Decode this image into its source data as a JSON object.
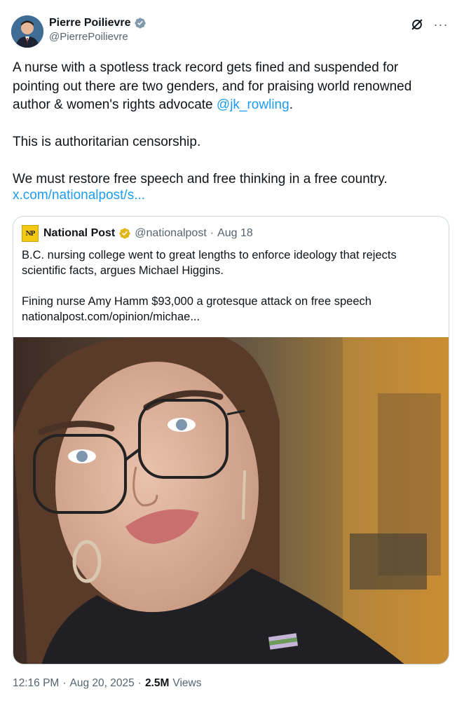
{
  "author": {
    "display_name": "Pierre Poilievre",
    "handle": "@PierrePoilievre",
    "verified_badge_color": "#536471"
  },
  "header_icons": [
    "grok-icon",
    "more-icon"
  ],
  "more_glyph": "···",
  "tweet": {
    "text_before_mention": "A nurse with a spotless track record gets fined and suspended for pointing out there are two genders, and for praising world renowned author & women's rights advocate ",
    "mention": "@jk_rowling",
    "text_after_mention": ".\n\nThis is authoritarian censorship.\n\nWe must restore free speech and free thinking in a free country.",
    "link": "x.com/nationalpost/s..."
  },
  "quote": {
    "logo_text": "NP",
    "name": "National Post",
    "handle": "@nationalpost",
    "separator": "·",
    "date": "Aug 18",
    "badge_color": "#e2b719",
    "line1": "B.C. nursing college went to great lengths to enforce ideology that rejects scientific facts, argues Michael Higgins.",
    "line2": "Fining nurse Amy Hamm $93,000 a grotesque attack on free speech",
    "link": "nationalpost.com/opinion/michae..."
  },
  "meta": {
    "time": "12:16 PM",
    "sep1": "·",
    "date": "Aug 20, 2025",
    "sep2": "·",
    "views_count": "2.5M",
    "views_label": "Views"
  },
  "colors": {
    "link": "#1d9bf0",
    "secondary_text": "#536471",
    "border": "#cfd9de"
  }
}
